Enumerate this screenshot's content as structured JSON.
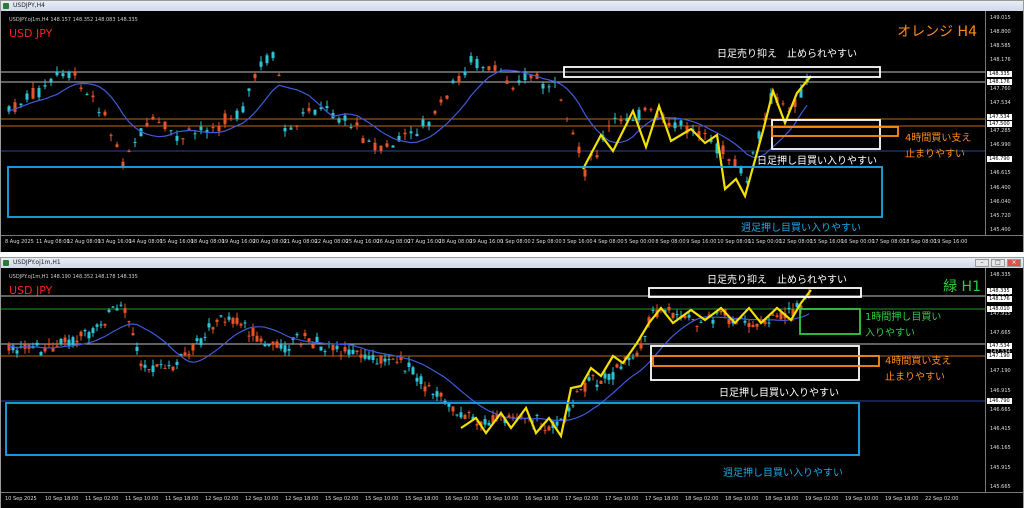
{
  "top": {
    "window_title": "USDJPY,H4",
    "info_line": "USDJPY.oj1m,H4  148.157 148.352 148.083 148.335",
    "symbol_label": "USD JPY",
    "timeframe_label": "オレンジ H4",
    "annotations": {
      "daily_sell": "日足売り抑え　止められやすい",
      "daily_buy": "日足押し目買い入りやすい",
      "h4_support": "4時間買い支え",
      "h4_support_2": "止まりやすい",
      "weekly_buy": "週足押し目買い入りやすい"
    },
    "y_ticks": [
      "149.015",
      "148.800",
      "148.585",
      "148.176",
      "148.010",
      "147.760",
      "147.534",
      "147.500",
      "147.285",
      "146.990",
      "146.840",
      "146.615",
      "146.400",
      "146.040",
      "145.720",
      "145.400"
    ],
    "x_ticks": [
      "8 Aug 2025",
      "11 Aug 08:00",
      "12 Aug 08:00",
      "13 Aug 16:00",
      "14 Aug 08:00",
      "15 Aug 16:00",
      "18 Aug 08:00",
      "19 Aug 16:00",
      "20 Aug 08:00",
      "21 Aug 08:00",
      "22 Aug 08:00",
      "25 Aug 16:00",
      "26 Aug 08:00",
      "27 Aug 16:00",
      "28 Aug 08:00",
      "29 Aug 16:00",
      "1 Sep 08:00",
      "2 Sep 08:00",
      "3 Sep 16:00",
      "4 Sep 08:00",
      "5 Sep 00:00",
      "8 Sep 08:00",
      "9 Sep 16:00",
      "10 Sep 08:00",
      "11 Sep 00:00",
      "12 Sep 08:00",
      "15 Sep 16:00",
      "16 Sep 00:00",
      "17 Sep 08:00",
      "18 Sep 08:00",
      "19 Sep 16:00"
    ],
    "price_tags": [
      "148.335",
      "148.176",
      "147.534",
      "147.500",
      "146.790"
    ]
  },
  "bottom": {
    "window_title": "USDJPY.oj1m,H1",
    "info_line": "USDJPY.oj1m,H1  148.190 148.352 148.178 148.335",
    "symbol_label": "USD JPY",
    "timeframe_label": "緑 H1",
    "annotations": {
      "daily_sell": "日足売り抑え　止められやすい",
      "h1_buy": "1時間押し目買い",
      "h1_buy_2": "入りやすい",
      "h4_support": "4時間買い支え",
      "h4_support_2": "止まりやすい",
      "daily_buy": "日足押し目買い入りやすい",
      "weekly_buy": "週足押し目買い入りやすい"
    },
    "y_ticks": [
      "148.335",
      "148.176",
      "147.915",
      "147.665",
      "147.534",
      "147.190",
      "146.915",
      "146.665",
      "146.415",
      "146.165",
      "145.915",
      "145.665"
    ],
    "x_ticks": [
      "10 Sep 2025",
      "10 Sep 18:00",
      "11 Sep 02:00",
      "11 Sep 10:00",
      "11 Sep 18:00",
      "12 Sep 02:00",
      "12 Sep 10:00",
      "12 Sep 18:00",
      "15 Sep 02:00",
      "15 Sep 10:00",
      "15 Sep 18:00",
      "16 Sep 02:00",
      "16 Sep 10:00",
      "16 Sep 18:00",
      "17 Sep 02:00",
      "17 Sep 10:00",
      "17 Sep 18:00",
      "18 Sep 02:00",
      "18 Sep 10:00",
      "18 Sep 18:00",
      "19 Sep 02:00",
      "19 Sep 10:00",
      "19 Sep 18:00",
      "22 Sep 02:00"
    ],
    "price_tags": [
      "148.335",
      "148.176",
      "148.010",
      "147.534",
      "147.190",
      "146.790"
    ]
  },
  "colors": {
    "background": "#000000",
    "bull_candle": "#2ec4d6",
    "bear_candle": "#e8542a",
    "ma_line": "#3d5bd9",
    "zigzag": "#f2e000",
    "zone_white": "#ffffff",
    "zone_orange": "#ff8c1a",
    "zone_cyan": "#1aa8e6",
    "zone_green": "#2ecc40",
    "symbol_red": "#ff2020",
    "tf_orange": "#ff8c1a",
    "tf_green": "#2ecc40"
  }
}
